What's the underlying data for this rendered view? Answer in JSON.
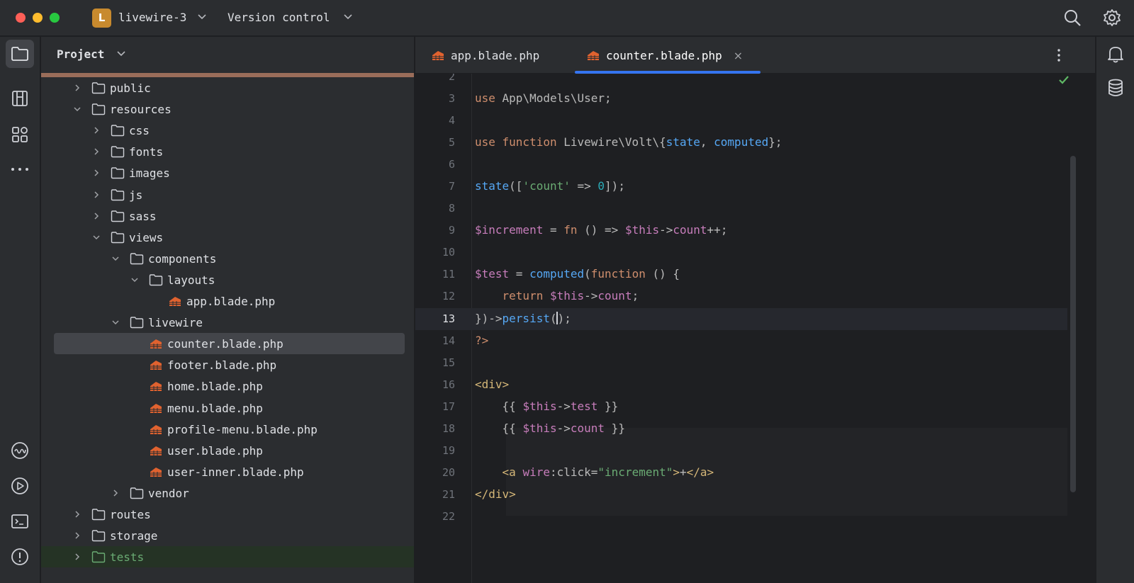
{
  "titlebar": {
    "project_initial": "L",
    "project_name": "livewire-3",
    "vcs_label": "Version control",
    "traffic_colors": [
      "#ff5f57",
      "#febc2e",
      "#28c840"
    ]
  },
  "left_strip": {
    "items": [
      "folder-icon",
      "structure-icon",
      "plugins-icon",
      "more-icon",
      "services-icon",
      "run-icon",
      "terminal-icon",
      "problems-icon"
    ]
  },
  "right_strip": {
    "items": [
      "notifications-icon",
      "database-icon"
    ]
  },
  "project_panel": {
    "title": "Project",
    "accent_color": "#9a6d5a",
    "tree": [
      {
        "label": "public",
        "type": "folder",
        "depth": 0,
        "expanded": false
      },
      {
        "label": "resources",
        "type": "folder",
        "depth": 0,
        "expanded": true
      },
      {
        "label": "css",
        "type": "folder",
        "depth": 1,
        "expanded": false
      },
      {
        "label": "fonts",
        "type": "folder",
        "depth": 1,
        "expanded": false
      },
      {
        "label": "images",
        "type": "folder",
        "depth": 1,
        "expanded": false
      },
      {
        "label": "js",
        "type": "folder",
        "depth": 1,
        "expanded": false
      },
      {
        "label": "sass",
        "type": "folder",
        "depth": 1,
        "expanded": false
      },
      {
        "label": "views",
        "type": "folder",
        "depth": 1,
        "expanded": true
      },
      {
        "label": "components",
        "type": "folder",
        "depth": 2,
        "expanded": true
      },
      {
        "label": "layouts",
        "type": "folder",
        "depth": 3,
        "expanded": true
      },
      {
        "label": "app.blade.php",
        "type": "blade",
        "depth": 4
      },
      {
        "label": "livewire",
        "type": "folder",
        "depth": 2,
        "expanded": true
      },
      {
        "label": "counter.blade.php",
        "type": "blade",
        "depth": 3,
        "selected": true
      },
      {
        "label": "footer.blade.php",
        "type": "blade",
        "depth": 3
      },
      {
        "label": "home.blade.php",
        "type": "blade",
        "depth": 3
      },
      {
        "label": "menu.blade.php",
        "type": "blade",
        "depth": 3
      },
      {
        "label": "profile-menu.blade.php",
        "type": "blade",
        "depth": 3
      },
      {
        "label": "user.blade.php",
        "type": "blade",
        "depth": 3
      },
      {
        "label": "user-inner.blade.php",
        "type": "blade",
        "depth": 3
      },
      {
        "label": "vendor",
        "type": "folder",
        "depth": 2,
        "expanded": false
      },
      {
        "label": "routes",
        "type": "folder",
        "depth": 0,
        "expanded": false
      },
      {
        "label": "storage",
        "type": "folder",
        "depth": 0,
        "expanded": false
      },
      {
        "label": "tests",
        "type": "folder",
        "depth": 0,
        "expanded": false,
        "highlight": "green"
      }
    ]
  },
  "editor": {
    "tabs": [
      {
        "label": "app.blade.php",
        "active": false
      },
      {
        "label": "counter.blade.php",
        "active": true,
        "close": "×"
      }
    ],
    "partial_top_line_number": "2",
    "current_line": "13",
    "lines": [
      {
        "num": "3",
        "tokens": [
          [
            "k",
            "use"
          ],
          [
            "a",
            " App\\Models\\User;"
          ]
        ]
      },
      {
        "num": "4",
        "tokens": []
      },
      {
        "num": "5",
        "tokens": [
          [
            "k",
            "use function"
          ],
          [
            "a",
            " Livewire\\Volt\\{"
          ],
          [
            "f",
            "state"
          ],
          [
            "a",
            ", "
          ],
          [
            "f",
            "computed"
          ],
          [
            "a",
            "};"
          ]
        ]
      },
      {
        "num": "6",
        "tokens": []
      },
      {
        "num": "7",
        "tokens": [
          [
            "f",
            "state"
          ],
          [
            "a",
            "(["
          ],
          [
            "s",
            "'count'"
          ],
          [
            "a",
            " => "
          ],
          [
            "n",
            "0"
          ],
          [
            "a",
            "]);"
          ]
        ]
      },
      {
        "num": "8",
        "tokens": []
      },
      {
        "num": "9",
        "tokens": [
          [
            "v",
            "$increment"
          ],
          [
            "a",
            " = "
          ],
          [
            "k",
            "fn"
          ],
          [
            "a",
            " () => "
          ],
          [
            "v",
            "$this"
          ],
          [
            "a",
            "->"
          ],
          [
            "v",
            "count"
          ],
          [
            "a",
            "++;"
          ]
        ]
      },
      {
        "num": "10",
        "tokens": []
      },
      {
        "num": "11",
        "tokens": [
          [
            "v",
            "$test"
          ],
          [
            "a",
            " = "
          ],
          [
            "f",
            "computed"
          ],
          [
            "a",
            "("
          ],
          [
            "k",
            "function"
          ],
          [
            "a",
            " () {"
          ]
        ]
      },
      {
        "num": "12",
        "tokens": [
          [
            "a",
            "    "
          ],
          [
            "k",
            "return"
          ],
          [
            "a",
            " "
          ],
          [
            "v",
            "$this"
          ],
          [
            "a",
            "->"
          ],
          [
            "v",
            "count"
          ],
          [
            "a",
            ";"
          ]
        ]
      },
      {
        "num": "13",
        "tokens": [
          [
            "a",
            "})->"
          ],
          [
            "f",
            "persist"
          ],
          [
            "a",
            "("
          ],
          [
            "caret",
            ""
          ],
          [
            "a",
            ");"
          ]
        ]
      },
      {
        "num": "14",
        "tokens": [
          [
            "k",
            "?>"
          ]
        ]
      },
      {
        "num": "15",
        "tokens": []
      },
      {
        "num": "16",
        "tokens": [
          [
            "t",
            "<div>"
          ]
        ]
      },
      {
        "num": "17",
        "tokens": [
          [
            "a",
            "    {{ "
          ],
          [
            "v",
            "$this"
          ],
          [
            "a",
            "->"
          ],
          [
            "v",
            "test"
          ],
          [
            "a",
            " }}"
          ]
        ]
      },
      {
        "num": "18",
        "tokens": [
          [
            "a",
            "    {{ "
          ],
          [
            "v",
            "$this"
          ],
          [
            "a",
            "->"
          ],
          [
            "v",
            "count"
          ],
          [
            "a",
            " }}"
          ]
        ]
      },
      {
        "num": "19",
        "tokens": []
      },
      {
        "num": "20",
        "tokens": [
          [
            "a",
            "    "
          ],
          [
            "t",
            "<a"
          ],
          [
            "a",
            " "
          ],
          [
            "v",
            "wire"
          ],
          [
            "a",
            ":click="
          ],
          [
            "s",
            "\"increment\""
          ],
          [
            "t",
            ">"
          ],
          [
            "a",
            "+"
          ],
          [
            "t",
            "</a>"
          ]
        ]
      },
      {
        "num": "21",
        "tokens": [
          [
            "t",
            "</div>"
          ]
        ]
      },
      {
        "num": "22",
        "tokens": []
      }
    ]
  }
}
